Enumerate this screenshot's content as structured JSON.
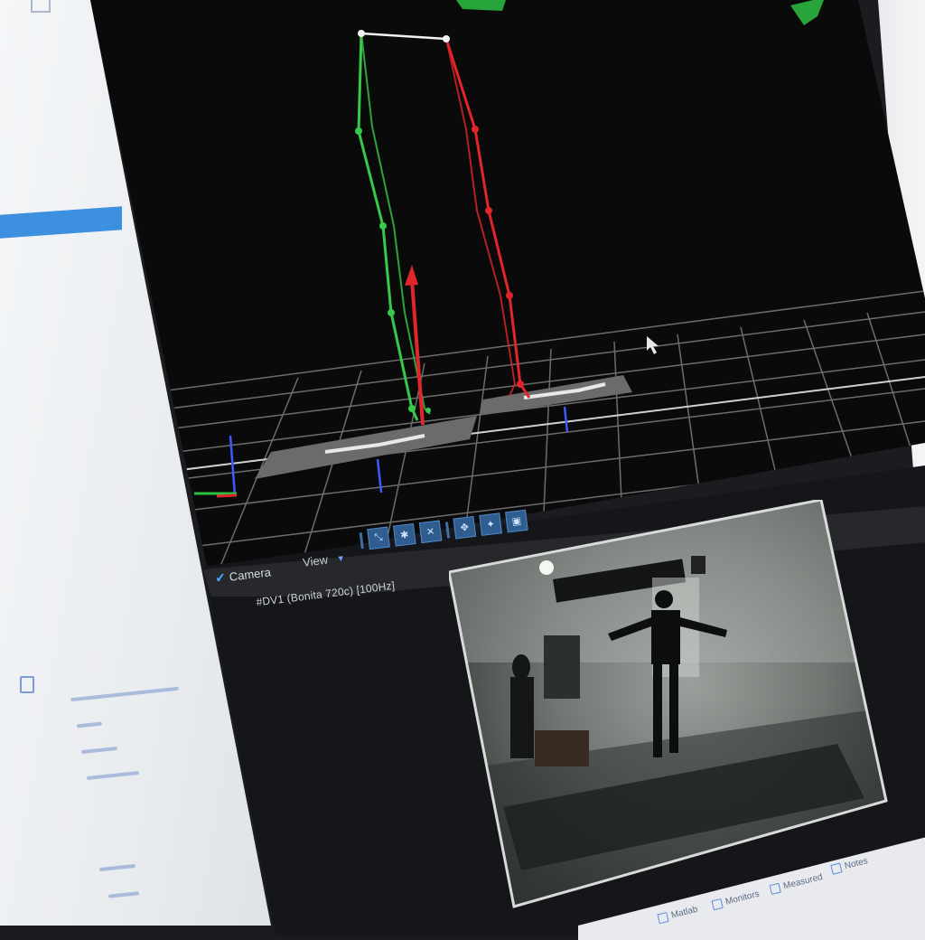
{
  "camera_panel": {
    "tab_label": "Camera",
    "view_menu": "View",
    "camera_label": "#DV1 (Bonita 720c) [100Hz]"
  },
  "viewport": {
    "skeleton_colors": {
      "left": "#36c94a",
      "right": "#e0262a",
      "hips": "#f2f2f2"
    },
    "grid_color": "#8b8b8b",
    "force_plate_color": "#8a8a8a"
  },
  "toolbar": {
    "icons": [
      "separator-icon",
      "zoom-extents-icon",
      "zoom-icon",
      "pan-icon",
      "separator-icon",
      "move-up-icon",
      "move-down-icon",
      "frame-icon"
    ]
  },
  "taskbar": {
    "items": [
      {
        "label": "Matlab",
        "icon": "matlab-icon"
      },
      {
        "label": "Monitors",
        "icon": "monitor-icon"
      },
      {
        "label": "Measured",
        "icon": "music-icon"
      },
      {
        "label": "Notes",
        "icon": "notes-icon"
      }
    ]
  },
  "colors": {
    "accent": "#3d8fe0",
    "toolbar_icon_bg": "#2f5d8f"
  }
}
